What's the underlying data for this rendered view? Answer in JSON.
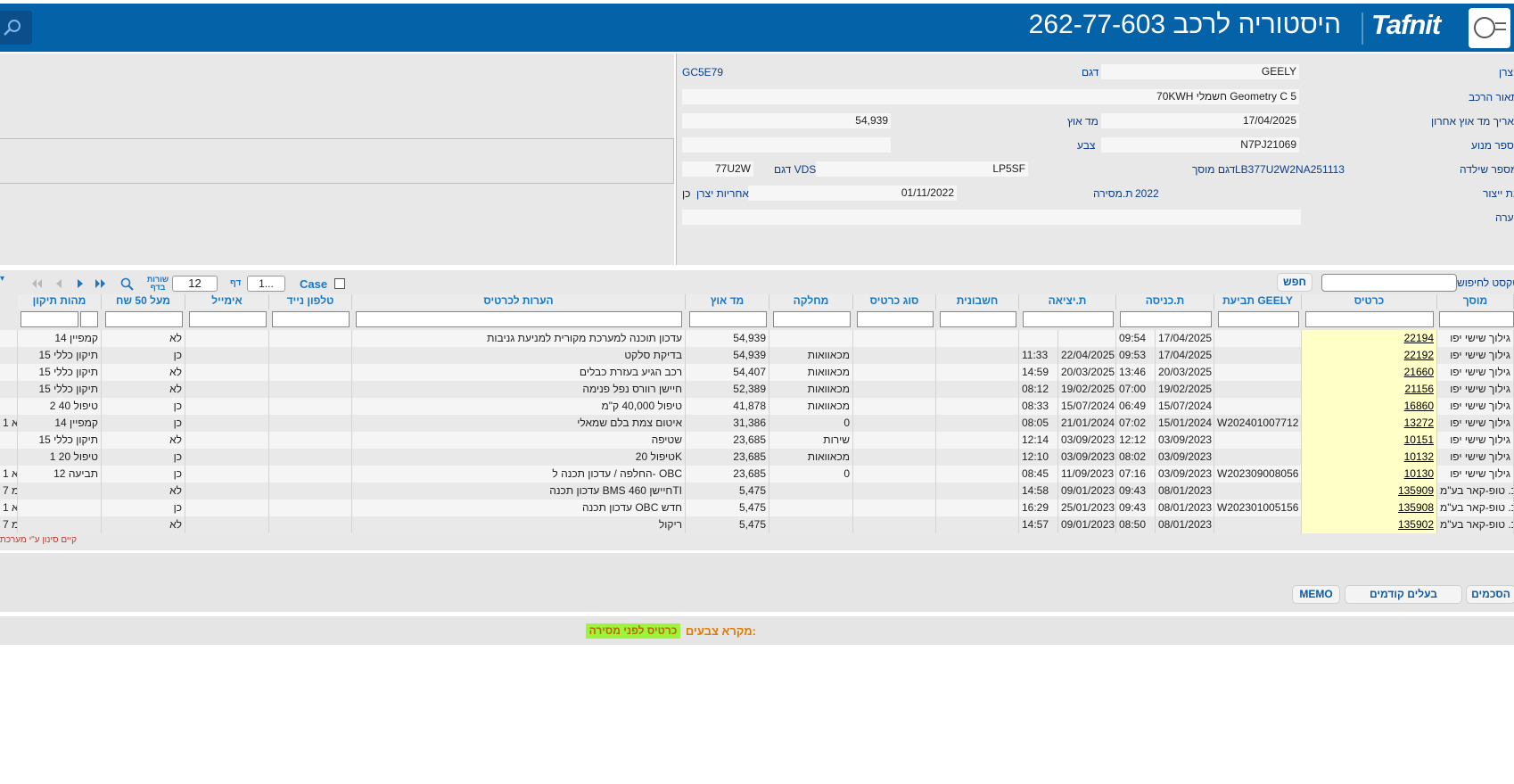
{
  "header": {
    "title": "היסטוריה לרכב 262-77-603",
    "brand": "Tafnit"
  },
  "details": {
    "customer_label": "צרן",
    "customer_value": "GEELY",
    "model_label": "דגם",
    "model_value": "GC5E79",
    "desc_label": "תאור הרכב",
    "desc_value": "70KWH חשמלי Geometry C 5",
    "last_odo_date_label": "תאריך מד אוץ אחרון",
    "last_odo_date_value": "17/04/2025",
    "odo_label": "מד אוץ",
    "odo_value": "54,939",
    "engine_label": "מספר מנוע",
    "engine_value": "N7PJ21069",
    "color_label": "צבע",
    "color_value": "",
    "chassis_label": "מספר שילדה",
    "chassis_value": "LB377U2W2NA251113",
    "addmodel_label": "דגם מוסך",
    "addmodel_value": "LP5SF",
    "vds_label": "דגם VDS",
    "vds_value": "77U2W",
    "year_label": "שנת ייצור",
    "year_value": "2022",
    "delivery_label": "ת.מסירה",
    "delivery_value": "01/11/2022",
    "warranty_label": "אחריות יצרן",
    "warranty_value": "כן",
    "note_label": "הערה",
    "note_value": ""
  },
  "toolbar": {
    "free_text_label": "טקסט לחיפוש",
    "search_placeholder": "",
    "search_button": "חפש",
    "case_label": "Case",
    "page_label": "דף",
    "page_value": "1...",
    "rows_label": "שורות בדף",
    "rows_value": "12"
  },
  "table": {
    "headers": [
      "מוסך",
      "כרטיס",
      "תביעת GEELY",
      "ת.כניסה",
      "ת.יציאה",
      "חשבונית",
      "סוג כרטיס",
      "מחלקה",
      "מד אוץ",
      "הערות לכרטיס",
      "טלפון נייד",
      "אימייל",
      "מעל 50 שח",
      "מהות תיקון"
    ],
    "rows": [
      {
        "garage": "גילוך שישי יפו",
        "card": "22194",
        "claim": "",
        "in_date": "17/04/2025",
        "in_time": "09:54",
        "out_date": "",
        "out_time": "",
        "invoice": "",
        "type": "",
        "dept": "",
        "odo": "54,939",
        "notes": "עדכון תוכנה למערכת מקורית למניעת גניבות",
        "phone": "",
        "email": "",
        "over50": "לא",
        "repair": "14 קמפיין"
      },
      {
        "garage": "גילוך שישי יפו",
        "card": "22192",
        "claim": "",
        "in_date": "17/04/2025",
        "in_time": "09:53",
        "out_date": "22/04/2025",
        "out_time": "11:33",
        "invoice": "",
        "type": "",
        "dept": "מכאוואות",
        "odo": "54,939",
        "notes": "בדיקת סלקט",
        "phone": "",
        "email": "",
        "over50": "כן",
        "repair": "15 תיקון כללי"
      },
      {
        "garage": "גילוך שישי יפו",
        "card": "21660",
        "claim": "",
        "in_date": "20/03/2025",
        "in_time": "13:46",
        "out_date": "20/03/2025",
        "out_time": "14:59",
        "invoice": "",
        "type": "",
        "dept": "מכאוואות",
        "odo": "54,407",
        "notes": "רכב הגיע בעזרת כבלים",
        "phone": "",
        "email": "",
        "over50": "לא",
        "repair": "15 תיקון כללי"
      },
      {
        "garage": "גילוך שישי יפו",
        "card": "21156",
        "claim": "",
        "in_date": "19/02/2025",
        "in_time": "07:00",
        "out_date": "19/02/2025",
        "out_time": "08:12",
        "invoice": "",
        "type": "",
        "dept": "מכאוואות",
        "odo": "52,389",
        "notes": "חיישן רוורס נפל פנימה",
        "phone": "",
        "email": "",
        "over50": "לא",
        "repair": "15 תיקון כללי"
      },
      {
        "garage": "גילוך שישי יפו",
        "card": "16860",
        "claim": "",
        "in_date": "15/07/2024",
        "in_time": "06:49",
        "out_date": "15/07/2024",
        "out_time": "08:33",
        "invoice": "",
        "type": "",
        "dept": "מכאוואות",
        "odo": "41,878",
        "notes": "טיפול 40,000 ק\"מ",
        "phone": "",
        "email": "",
        "over50": "כן",
        "repair": "2 טיפול 40"
      },
      {
        "garage": "גילוך שישי יפו",
        "card": "13272",
        "claim": "W202401007712",
        "in_date": "15/01/2024",
        "in_time": "07:02",
        "out_date": "21/01/2024",
        "out_time": "08:05",
        "invoice": "",
        "type": "",
        "dept": "0",
        "odo": "31,386",
        "notes": "איטום צמת בלם שמאלי",
        "phone": "",
        "email": "",
        "over50": "כן",
        "repair": "14 קמפיין"
      },
      {
        "garage": "גילוך שישי יפו",
        "card": "10151",
        "claim": "",
        "in_date": "03/09/2023",
        "in_time": "12:12",
        "out_date": "03/09/2023",
        "out_time": "12:14",
        "invoice": "",
        "type": "",
        "dept": "שירות",
        "odo": "23,685",
        "notes": "שטיפה",
        "phone": "",
        "email": "",
        "over50": "לא",
        "repair": "15 תיקון כללי"
      },
      {
        "garage": "גילוך שישי יפו",
        "card": "10132",
        "claim": "",
        "in_date": "03/09/2023",
        "in_time": "08:02",
        "out_date": "03/09/2023",
        "out_time": "12:10",
        "invoice": "",
        "type": "",
        "dept": "מכאוואות",
        "odo": "23,685",
        "notes": "טיפול 20K",
        "phone": "",
        "email": "",
        "over50": "כן",
        "repair": "1 טיפול 20"
      },
      {
        "garage": "גילוך שישי יפו",
        "card": "10130",
        "claim": "W202309008056",
        "in_date": "03/09/2023",
        "in_time": "07:16",
        "out_date": "11/09/2023",
        "out_time": "08:45",
        "invoice": "",
        "type": "",
        "dept": "0",
        "odo": "23,685",
        "notes": "החלפה / עדכון תכנה ל- OBC",
        "phone": "",
        "email": "",
        "over50": "כן",
        "repair": "12 תביעה"
      },
      {
        "garage": "ע.כ. טופ-קאר בע\"מ",
        "card": "135909",
        "claim": "",
        "in_date": "08/01/2023",
        "in_time": "09:43",
        "out_date": "09/01/2023",
        "out_time": "14:58",
        "invoice": "",
        "type": "",
        "dept": "",
        "odo": "5,475",
        "notes": "עדכון תכנה BMS חיישן 460TI",
        "phone": "",
        "email": "",
        "over50": "לא",
        "repair": ""
      },
      {
        "garage": "ע.כ. טופ-קאר בע\"מ",
        "card": "135908",
        "claim": "W202301005156",
        "in_date": "08/01/2023",
        "in_time": "09:43",
        "out_date": "25/01/2023",
        "out_time": "16:29",
        "invoice": "",
        "type": "",
        "dept": "",
        "odo": "5,475",
        "notes": "עדכון תכנה OBC חדש",
        "phone": "",
        "email": "",
        "over50": "כן",
        "repair": ""
      },
      {
        "garage": "ע.כ. טופ-קאר בע\"מ",
        "card": "135902",
        "claim": "",
        "in_date": "08/01/2023",
        "in_time": "08:50",
        "out_date": "09/01/2023",
        "out_time": "14:57",
        "invoice": "",
        "type": "",
        "dept": "",
        "odo": "5,475",
        "notes": "ריקול",
        "phone": "",
        "email": "",
        "over50": "לא",
        "repair": ""
      }
    ],
    "left_clip": [
      "",
      "",
      "",
      "",
      "",
      "1 א",
      "",
      "",
      "1 א",
      "7 מ",
      "1 א",
      "7 מ"
    ]
  },
  "filter_note": "קיים סינון ע\"י מערכת",
  "buttons": {
    "approvals": "הסכמים",
    "prev_owners": "בעלים קודמים",
    "memo": "MEMO"
  },
  "legend": {
    "label": "מקרא צבעים:",
    "chip": "כרטיס לפני מסירה",
    "chip_color": "#9cf53a"
  },
  "colors": {
    "header_bg": "#0362a8",
    "accent": "#1877c8"
  }
}
